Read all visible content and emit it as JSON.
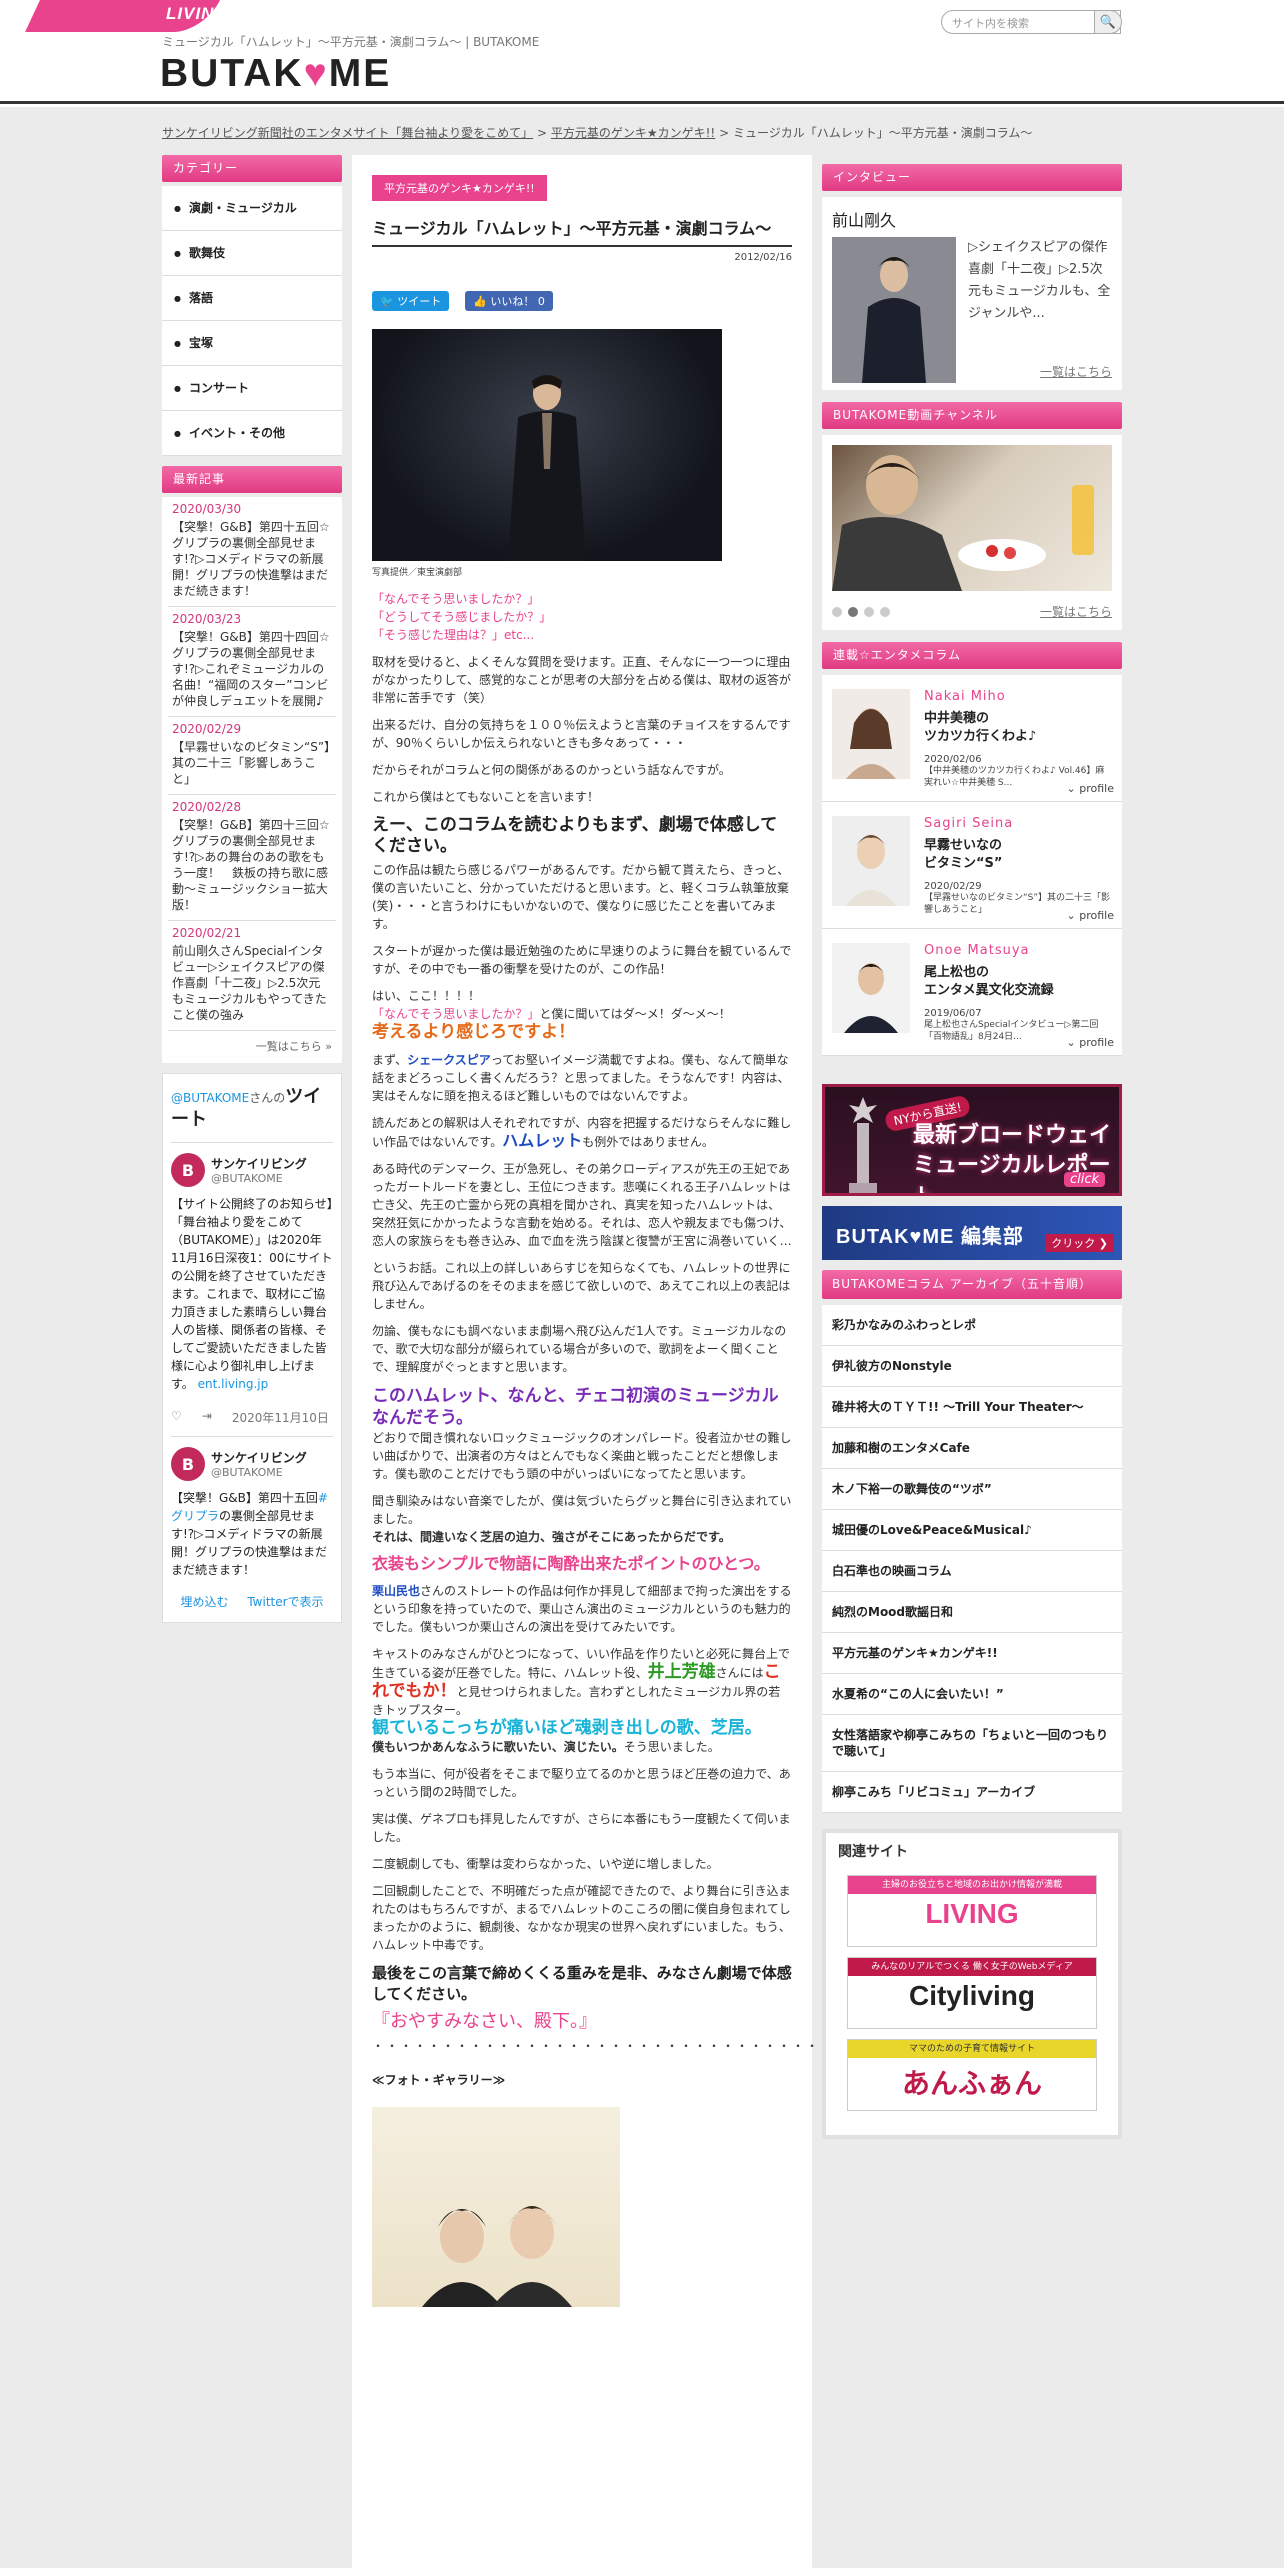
{
  "header": {
    "living_logo": "LIVING",
    "site_desc": "ミュージカル「ハムレット」～平方元基・演劇コラム～ | BUTAKOME",
    "brand_left": "BUTAK",
    "brand_heart": "♥",
    "brand_right": "ME",
    "search_placeholder": "サイト内を検索",
    "search_icon": "magnifier-icon"
  },
  "breadcrumb": {
    "link1": "サンケイリビング新聞社のエンタメサイト「舞台袖より愛をこめて」",
    "sep1": " > ",
    "link2": "平方元基のゲンキ★カンゲキ!!",
    "sep2": " > ",
    "current": "ミュージカル「ハムレット」～平方元基・演劇コラム～"
  },
  "left_sidebar": {
    "category_title": "カテゴリー",
    "categories": [
      "演劇・ミュージカル",
      "歌舞伎",
      "落語",
      "宝塚",
      "コンサート",
      "イベント・その他"
    ],
    "news_title": "最新記事",
    "news": [
      {
        "date": "2020/03/30",
        "text": "【突撃！G&B】第四十五回☆グリプラの裏側全部見せます!?▷コメディドラマの新展開！グリプラの快進撃はまだまだ続きます！"
      },
      {
        "date": "2020/03/23",
        "text": "【突撃！G&B】第四十四回☆グリプラの裏側全部見せます!?▷これぞミュージカルの名曲！“福岡のスター”コンビが仲良しデュエットを展開♪"
      },
      {
        "date": "2020/02/29",
        "text": "【早霧せいなのビタミン“S”】其の二十三「影響しあうこと」"
      },
      {
        "date": "2020/02/28",
        "text": "【突撃！G&B】第四十三回☆グリプラの裏側全部見せます!?▷あの舞台のあの歌をもう一度！　鉄板の持ち歌に感動～ミュージックショー拡大版！"
      },
      {
        "date": "2020/02/21",
        "text": "前山剛久さんSpecialインタビュー▷シェイクスピアの傑作喜劇「十二夜」▷2.5次元もミュージカルもやってきたこと僕の強み"
      }
    ],
    "news_more": "一覧はこちら »",
    "twitter": {
      "head_prefix": "@BUTAKOME",
      "head_mid": "さんの",
      "head_big": "ツイート",
      "tweets": [
        {
          "name": "サンケイリビング",
          "handle": "@BUTAKOME",
          "text": "【サイト公開終了のお知らせ】「舞台袖より愛をこめて（BUTAKOME）」は2020年11月16日深夜1：00にサイトの公開を終了させていただきます。これまで、取材にご協力頂きました素晴らしい舞台人の皆様、関係者の皆様、そしてご愛読いただきました皆様に心より御礼申し上げます。",
          "link": "ent.living.jp",
          "date": "2020年11月10日"
        },
        {
          "name": "サンケイリビング",
          "handle": "@BUTAKOME",
          "text": "【突撃！G&B】第四十五回",
          "link": "#グリプラ",
          "text2": "の裏側全部見せます!?▷コメディドラマの新展開！グリプラの快進撃はまだまだ続きます！"
        }
      ],
      "embed": "埋め込む",
      "view_on": "Twitterで表示"
    }
  },
  "main": {
    "tag": "平方元基のゲンキ★カンゲキ!!",
    "title": "ミュージカル「ハムレット」～平方元基・演劇コラム～",
    "date": "2012/02/16",
    "tweet_btn": "ツイート",
    "like_btn": "いいね！ 0",
    "photo_caption": "写真提供／東宝演劇部",
    "p1": [
      "「なんでそう思いましたか？」",
      "「どうしてそう感じましたか？」",
      "「そう感じた理由は？」etc..."
    ],
    "p2": "取材を受けると、よくそんな質問を受けます。正直、そんなに一つ一つに理由がなかったりして、感覚的なことが思考の大部分を占める僕は、取材の返答が非常に苦手です（笑）",
    "p3": "出来るだけ、自分の気持ちを１００％伝えようと言葉のチョイスをするんですが、90％くらいしか伝えられないときも多々あって・・・",
    "p4": "だからそれがコラムと何の関係があるのかっという話なんですが。",
    "p5": "これから僕はとてもないことを言います！",
    "h1": "えー、このコラムを読むよりもまず、劇場で体感してください。",
    "p6": "この作品は観たら感じるパワーがあるんです。だから観て貰えたら、きっと、僕の言いたいこと、分かっていただけると思います。と、軽くコラム執筆放棄(笑)・・・と言うわけにもいかないので、僕なりに感じたことを書いてみます。",
    "p7": "スタートが遅かった僕は最近勉強のために早速りのように舞台を観ているんですが、その中でも一番の衝撃を受けたのが、この作品！",
    "p8a": "はい、ここ！！！！",
    "p8b": "「なんでそう思いましたか？」",
    "p8c": "と僕に聞いてはダ～メ！ダ～メ～！",
    "h2": "考えるより感じろですよ！",
    "p9a": "まず、",
    "p9b": "シェークスピア",
    "p9c": "ってお堅いイメージ満載ですよね。僕も、なんて簡単な話をまどろっこしく書くんだろう？と思ってました。そうなんです！内容は、実はそんなに頭を抱えるほど難しいものではないんですよ。",
    "p10a": "読んだあとの解釈は人それぞれですが、内容を把握するだけならそんなに難しい作品ではないんです。",
    "p10b": "ハムレット",
    "p10c": "も例外ではありません。",
    "p11": "ある時代のデンマーク、王が急死し、その弟クローディアスが先王の王妃であったガートルードを妻とし、王位につきます。悲嘆にくれる王子ハムレットは亡き父、先王の亡霊から死の真相を聞かされ、真実を知ったハムレットは、突然狂気にかかったような言動を始める。それは、恋人や親友までも傷つけ、恋人の家族らをも巻き込み、血で血を洗う陰謀と復讐が王宮に渦巻いていく…",
    "p12": "というお話。これ以上の詳しいあらすじを知らなくても、ハムレットの世界に飛び込んであげるのをそのままを感じて欲しいので、あえてこれ以上の表記はしません。",
    "p13": "勿論、僕もなにも調べないまま劇場へ飛び込んだ1人です。ミュージカルなので、歌で大切な部分が綴られている場合が多いので、歌詞をよーく聞くことで、理解度がぐっとますと思います。",
    "h3": "このハムレット、なんと、チェコ初演のミュージカルなんだそう。",
    "p14": "どおりで聞き慣れないロックミュージックのオンパレード。役者泣かせの難しい曲ばかりで、出演者の方々はとんでもなく楽曲と戦ったことだと想像します。僕も歌のことだけでもう頭の中がいっぱいになってたと思います。",
    "p15a": "聞き馴染みはない音楽でしたが、僕は気づいたらグッと舞台に引き込まれていました。",
    "p15b": "それは、間違いなく芝居の迫力、強さがそこにあったからだです。",
    "h4": "衣装もシンプルで物語に陶酔出来たポイントのひとつ。",
    "p16a": "栗山民也",
    "p16b": "さんのストレートの作品は何作か拝見して細部まで拘った演出をするという印象を持っていたので、栗山さん演出のミュージカルというのも魅力的でした。僕もいつか栗山さんの演出を受けてみたいです。",
    "p17a": "キャストのみなさんがひとつになって、いい作品を作りたいと必死に舞台上で生きている姿が圧巻でした。特に、ハムレット役、",
    "p17b": "井上芳雄",
    "p17c": "さんには",
    "p17d": "これでもか！",
    "p17e": "と見せつけられました。言わずとしれたミュージカル界の若きトップスター。",
    "h5": "観ているこっちが痛いほど魂剥き出しの歌、芝居。",
    "p18a": "僕もいつかあんなふうに歌いたい、演じたい。",
    "p18b": "そう思いました。",
    "p19": "もう本当に、何が役者をそこまで駆り立てるのかと思うほど圧巻の迫力で、あっという間の2時間でした。",
    "p20": "実は僕、ゲネプロも拝見したんですが、さらに本番にもう一度観たくて伺いました。",
    "p21": "二度観劇しても、衝撃は変わらなかった、いや逆に増しました。",
    "p22": "二回観劇したことで、不明確だった点が確認できたので、より舞台に引き込まれたのはもちろんですが、まるでハムレットのこころの闇に僕自身包まれてしまったかのように、観劇後、なかなか現実の世界へ戻れずにいました。もう、ハムレット中毒です。",
    "h6": "最後をこの言葉で締めくくる重みを是非、みなさん劇場で体感してください。",
    "quote": "『おやすみなさい、殿下。』",
    "dots": "・・・・・・・・・・・・・・・・・・・・・・・・・・・・・・・・・・・・・・・・・・",
    "gallery": "≪フォト・ギャラリー≫"
  },
  "right_sidebar": {
    "interview_title": "インタビュー",
    "interview_name": "前山剛久",
    "interview_text": "▷シェイクスピアの傑作喜劇「十二夜」▷2.5次元もミュージカルも、全ジャンルや...",
    "interview_more": "一覧はこちら",
    "video_title": "BUTAKOME動画チャンネル",
    "video_more": "一覧はこちら",
    "columns_title": "連載☆エンタメコラム",
    "columns": [
      {
        "name": "Nakai Miho",
        "title1": "中井美穂の",
        "title2": "ツカツカ行くわよ♪",
        "date": "2020/02/06",
        "desc": "【中井美穂のツカツカ行くわよ♪ Vol.46】麻実れい☆中井美穂 S...",
        "profile": "profile"
      },
      {
        "name": "Sagiri Seina",
        "title1": "早霧せいなの",
        "title2": "ビタミン“S”",
        "date": "2020/02/29",
        "desc": "【早霧せいなのビタミン“S”】其の二十三「影響しあうこと」",
        "profile": "profile"
      },
      {
        "name": "Onoe Matsuya",
        "title1": "尾上松也の",
        "title2": "エンタメ異文化交流録",
        "date": "2019/06/07",
        "desc": "尾上松也さんSpecialインタビュー▷第二回「百物語乱」8月24日...",
        "profile": "profile"
      }
    ],
    "banner_bw": {
      "t1": "NYから直送!",
      "t2": "最新ブロードウェイ",
      "t3": "ミュージカルレポート",
      "t4": "click"
    },
    "banner_ed": {
      "t1": "BUTAK♥ME 編集部",
      "t2": "クリック ❯"
    },
    "archive_title": "BUTAKOMEコラム アーカイブ（五十音順）",
    "archive": [
      "彩乃かなみのふわっとレポ",
      "伊礼彼方のNonstyle",
      "碓井将大のＴＹＴ!! 〜Trill Your Theater〜",
      "加藤和樹のエンタメCafe",
      "木ノ下裕一の歌舞伎の“ツボ”",
      "城田優のLove&Peace&Musical♪",
      "白石準也の映画コラム",
      "純烈のMood歌謡日和",
      "平方元基のゲンキ★カンゲキ!!",
      "水夏希の“この人に会いたい！”",
      "女性落語家や柳亭こみちの「ちょいと一回のつもりで聴いて」",
      "柳亭こみち「リビコミュ」アーカイブ"
    ],
    "related_title": "関連サイト",
    "related": [
      {
        "strip": "主婦のお役立ちと地域のお出かけ情報が満載",
        "logo": "LIVING",
        "color": "#e8438c"
      },
      {
        "strip": "みんなのリアルでつくる 働く女子のWebメディア",
        "logo": "Cityliving",
        "color": "#222222"
      },
      {
        "strip": "ママのための子育て情報サイト",
        "logo": "あんふぁん",
        "color": "#c01a4a"
      }
    ]
  }
}
